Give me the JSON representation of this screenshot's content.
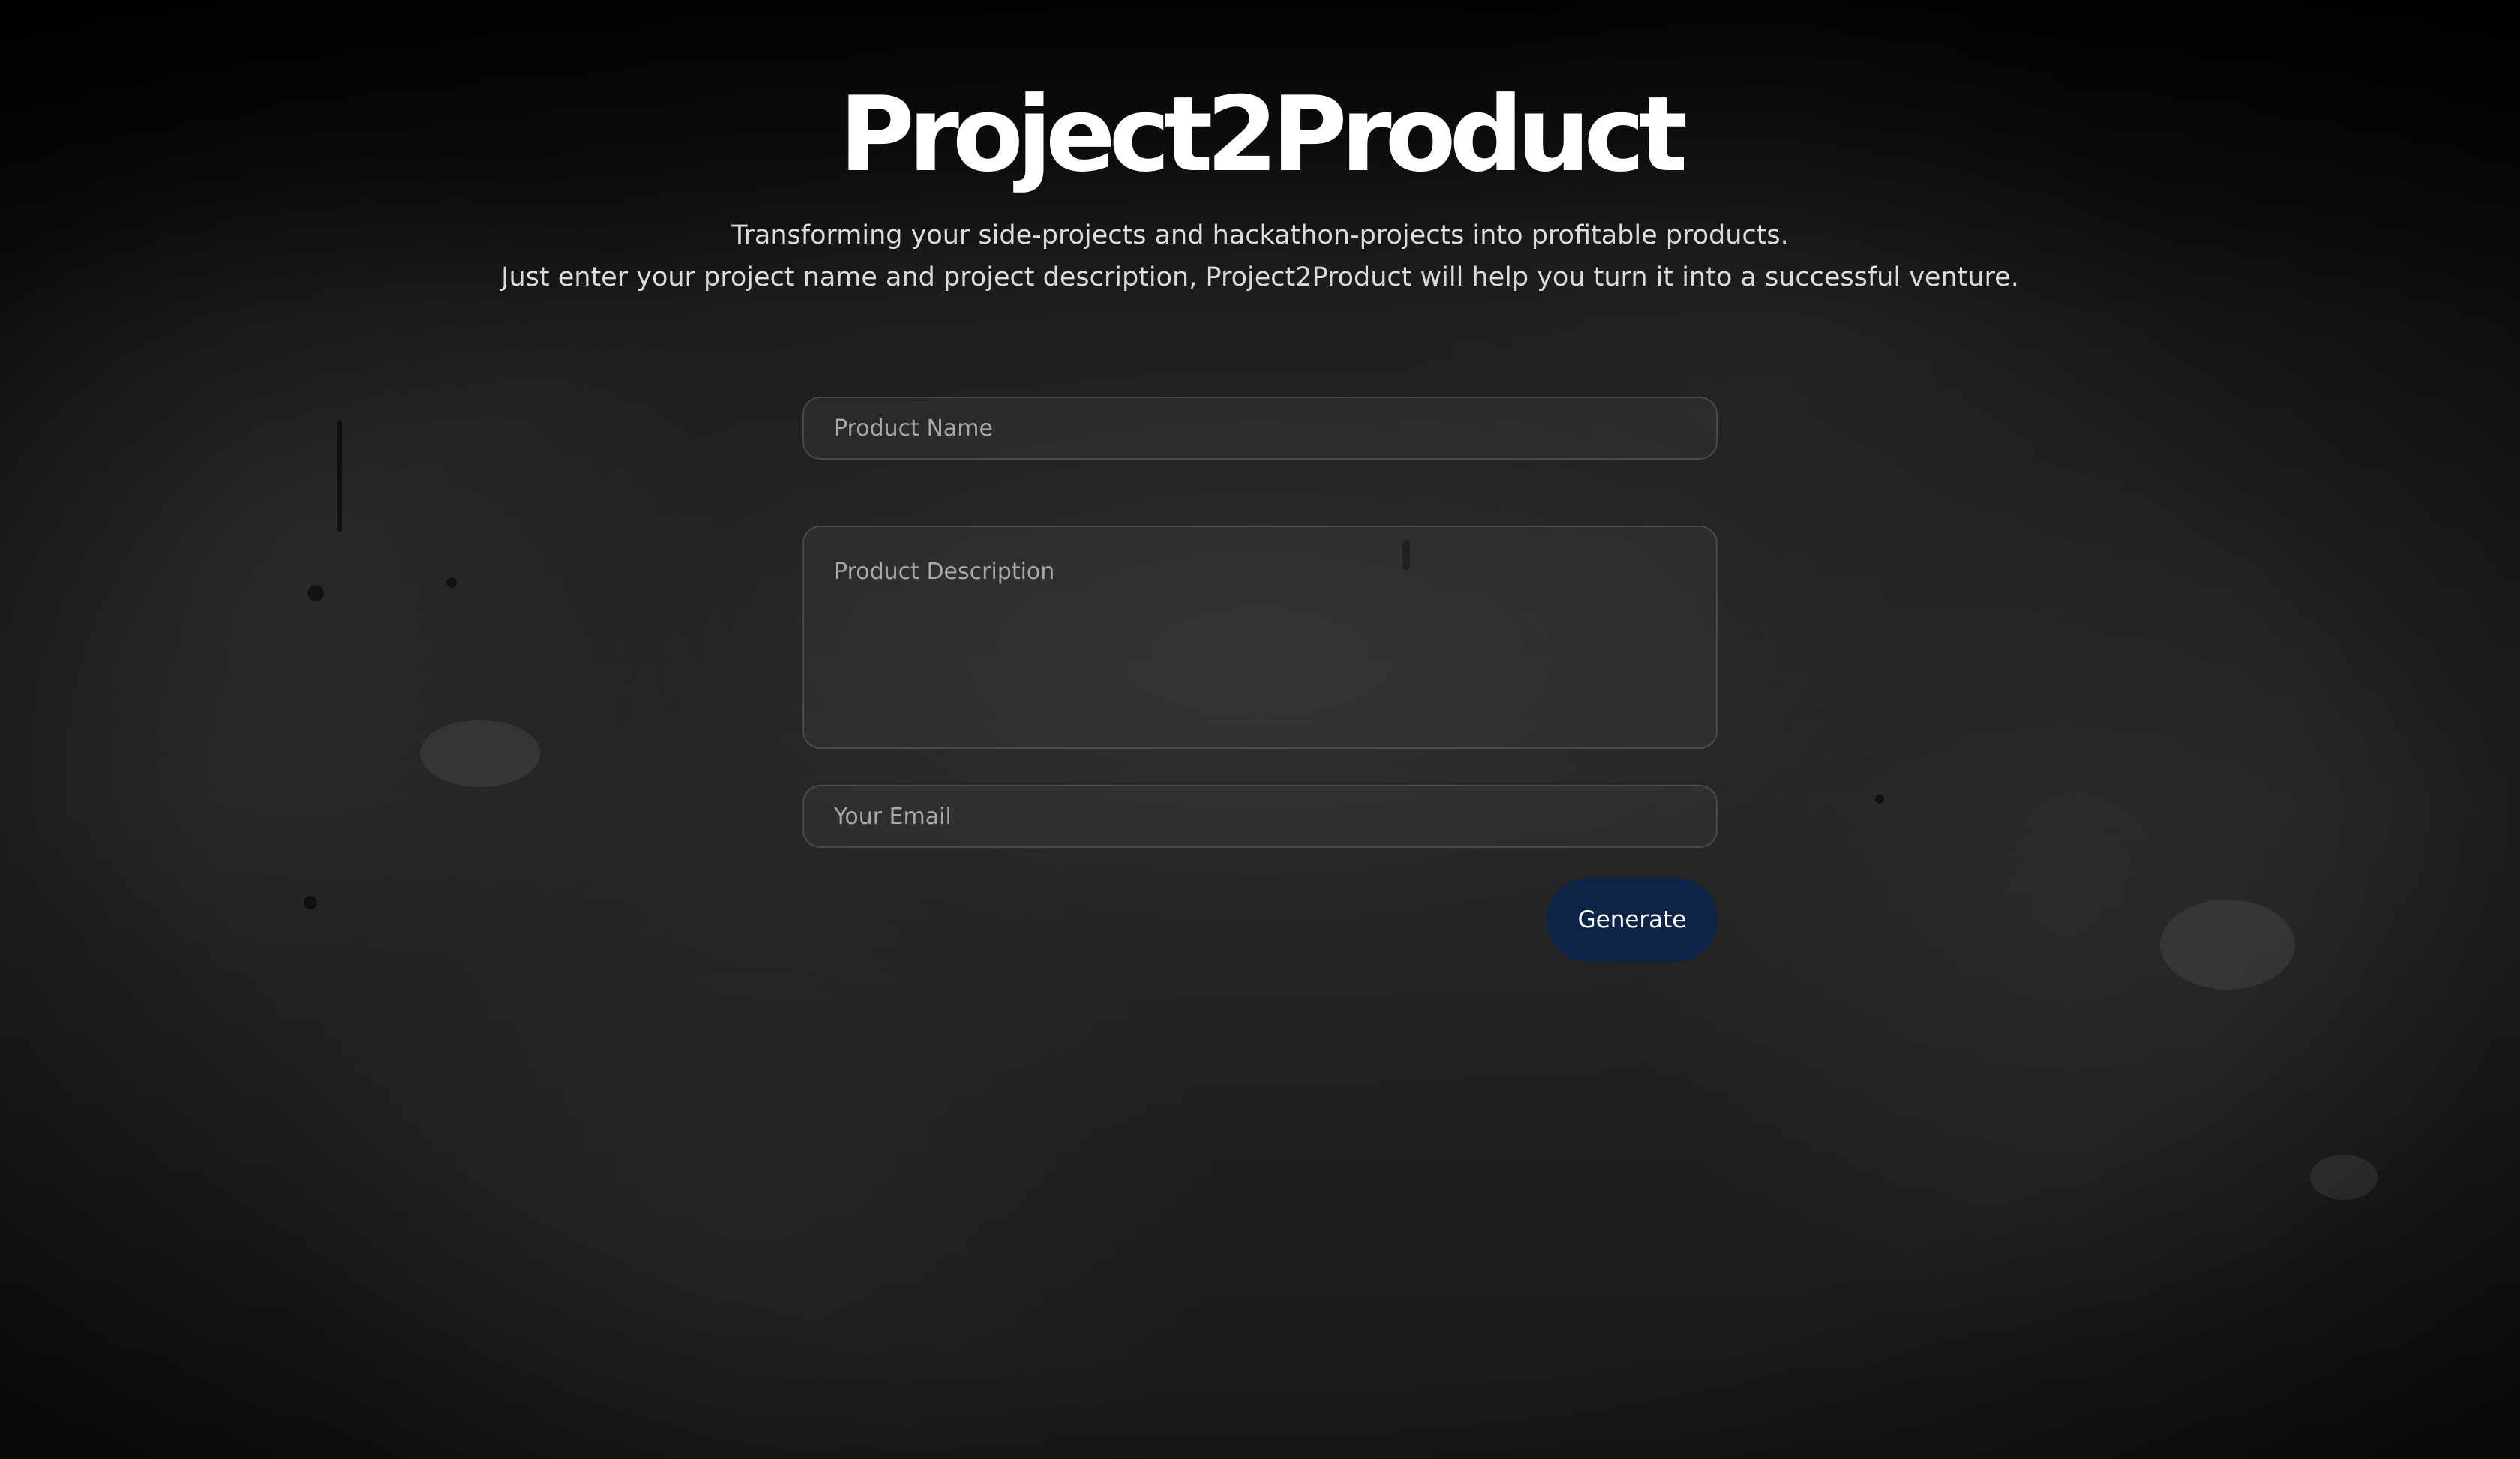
{
  "header": {
    "title": "Project2Product",
    "subtitle_line1": "Transforming your side-projects and hackathon-projects into profitable products.",
    "subtitle_line2": "Just enter your project name and project description, Project2Product will help you turn it into a successful venture."
  },
  "form": {
    "product_name": {
      "placeholder": "Product Name",
      "value": ""
    },
    "product_description": {
      "placeholder": "Product Description",
      "value": ""
    },
    "email": {
      "placeholder": "Your Email",
      "value": ""
    },
    "generate_label": "Generate"
  },
  "colors": {
    "background": "#1a1a1a",
    "button": "#0b2447",
    "title": "#ffffff"
  }
}
